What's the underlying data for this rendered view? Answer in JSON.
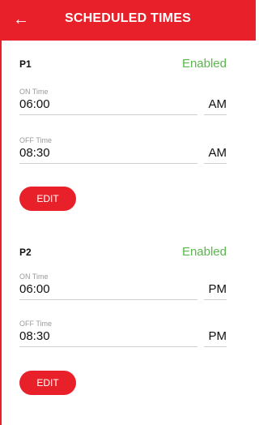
{
  "header": {
    "title": "SCHEDULED TIMES",
    "back_icon": "←"
  },
  "programs": [
    {
      "name": "P1",
      "status": "Enabled",
      "on_label": "ON Time",
      "on_time": "06:00",
      "on_ampm": "AM",
      "off_label": "OFF Time",
      "off_time": "08:30",
      "off_ampm": "AM",
      "edit_label": "EDIT"
    },
    {
      "name": "P2",
      "status": "Enabled",
      "on_label": "ON Time",
      "on_time": "06:00",
      "on_ampm": "PM",
      "off_label": "OFF Time",
      "off_time": "08:30",
      "off_ampm": "PM",
      "edit_label": "EDIT"
    }
  ],
  "colors": {
    "accent": "#e8202a",
    "enabled": "#58b84b"
  }
}
